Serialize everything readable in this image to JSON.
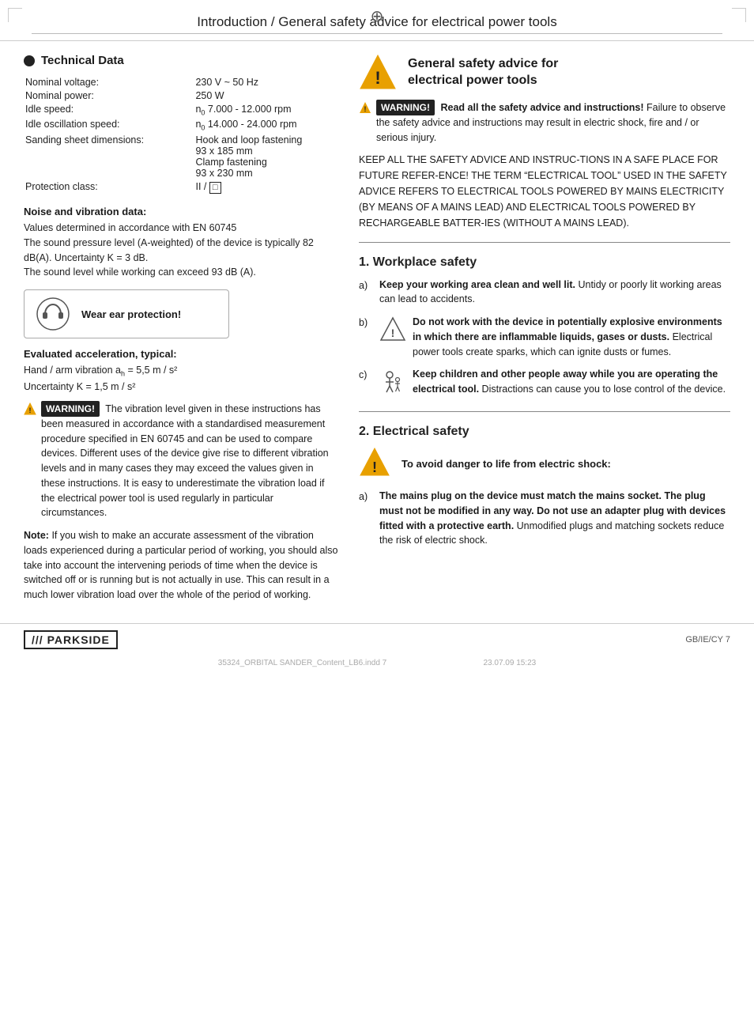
{
  "header": {
    "title": "Introduction / General safety advice for electrical power tools"
  },
  "left": {
    "technical_data": {
      "section_title": "Technical Data",
      "rows": [
        {
          "label": "Nominal voltage:",
          "value": "230 V ~ 50 Hz"
        },
        {
          "label": "Nominal power:",
          "value": "250 W"
        },
        {
          "label": "Idle speed:",
          "value": "n₀ 7.000 - 12.000 rpm"
        },
        {
          "label": "Idle oscillation speed:",
          "value": "n₀ 14.000 - 24.000 rpm"
        },
        {
          "label": "Sanding sheet dimensions:",
          "value": "Hook and loop fastening\n93 x 185 mm\nClamp fastening\n93 x 230 mm"
        },
        {
          "label": "Protection class:",
          "value": "II / □"
        }
      ]
    },
    "noise_vibration": {
      "title": "Noise and vibration data:",
      "body": "Values determined in accordance with EN 60745\nThe sound pressure level (A-weighted) of the device is typically 82 dB(A). Uncertainty K = 3 dB.\nThe sound level while working can exceed 93 dB (A)."
    },
    "ear_protection": {
      "label": "Wear ear protection!"
    },
    "acceleration": {
      "title": "Evaluated acceleration, typical:",
      "line1": "Hand / arm vibration aₕ = 5,5 m / s²",
      "line2": "Uncertainty K = 1,5 m / s²"
    },
    "warning_vibration": {
      "prefix": "WARNING!",
      "text": "The vibration level given in these instructions has been measured in accordance with a standardised measurement procedure specified in EN 60745 and can be used to compare devices. Different uses of the device give rise to different vibration levels and in many cases they may exceed the values given in these instructions. It is easy to underestimate the vibration load if the electrical power tool is used regularly in particular circumstances."
    },
    "note": {
      "label": "Note:",
      "text": "If you wish to make an accurate assessment of the vibration loads experienced during a particular period of working, you should also take into account the intervening periods of time when the device is switched off or is running but is not actually in use. This can result in a much lower vibration load over the whole of the period of working."
    }
  },
  "right": {
    "safety_title_line1": "General safety advice for",
    "safety_title_line2": "electrical power tools",
    "warning_read": {
      "prefix": "WARNING!",
      "bold": "Read all the safety advice and instructions!",
      "text": "Failure to observe the safety advice and instructions may result in electric shock, fire and / or serious injury."
    },
    "keep_all": "KEEP ALL THE SAFETY ADVICE AND INSTRUC-TIONS IN A SAFE PLACE FOR FUTURE REFER-ENCE! THE TERM “ELECTRICAL TOOL” USED IN THE SAFETY ADVICE REFERS TO ELECTRICAL TOOLS POWERED BY MAINS ELECTRICITY (BY MEANS OF A MAINS LEAD) AND ELECTRICAL TOOLS POWERED BY RECHARGEABLE BATTER-IES (WITHOUT A MAINS LEAD).",
    "section1": {
      "title": "1.  Workplace safety",
      "items": [
        {
          "letter": "a)",
          "bold": "Keep your working area clean and well lit.",
          "text": "Untidy or poorly lit working areas can lead to accidents.",
          "has_icon": false
        },
        {
          "letter": "b)",
          "bold": "Do not work with the device in potentially explosive environments in which there are inflammable liquids, gases or dusts.",
          "text": "Electrical power tools create sparks, which can ignite dusts or fumes.",
          "has_icon": true
        },
        {
          "letter": "c)",
          "bold": "Keep children and other people away while you are operating the electrical tool.",
          "text": "Distractions can cause you to lose control of the device.",
          "has_icon": true
        }
      ]
    },
    "section2": {
      "title": "2.  Electrical safety",
      "danger_note": {
        "bold": "To avoid danger to life from electric shock:"
      },
      "items": [
        {
          "letter": "a)",
          "bold": "The mains plug on the device must match the mains socket. The plug must not be modified in any way. Do not use an adapter plug with devices fitted with a protective earth.",
          "text": "Unmodified plugs and matching sockets reduce the risk of electric shock.",
          "has_icon": false
        }
      ]
    }
  },
  "footer": {
    "logo": "/// PARKSIDE",
    "page_info": "GB/IE/CY    7",
    "file_info": "35324_ORBITAL SANDER_Content_LB6.indd   7",
    "date_info": "23.07.09   15:23"
  }
}
